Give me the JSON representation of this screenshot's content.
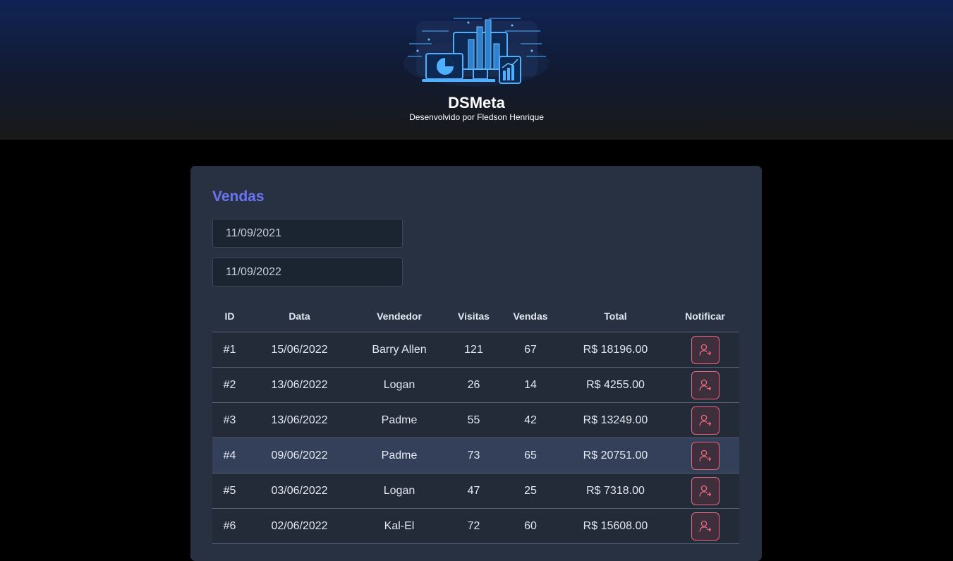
{
  "header": {
    "title": "DSMeta",
    "subtitle": "Desenvolvido por Fledson Henrique",
    "logo_icon": "dashboard-devices-illustration"
  },
  "sales": {
    "title": "Vendas",
    "filters": {
      "min_date": "11/09/2021",
      "max_date": "11/09/2022"
    },
    "columns": [
      "ID",
      "Data",
      "Vendedor",
      "Visitas",
      "Vendas",
      "Total",
      "Notificar"
    ],
    "rows": [
      {
        "id": "#1",
        "date": "15/06/2022",
        "seller": "Barry Allen",
        "visits": "121",
        "sales": "67",
        "total": "R$ 18196.00"
      },
      {
        "id": "#2",
        "date": "13/06/2022",
        "seller": "Logan",
        "visits": "26",
        "sales": "14",
        "total": "R$ 4255.00"
      },
      {
        "id": "#3",
        "date": "13/06/2022",
        "seller": "Padme",
        "visits": "55",
        "sales": "42",
        "total": "R$ 13249.00"
      },
      {
        "id": "#4",
        "date": "09/06/2022",
        "seller": "Padme",
        "visits": "73",
        "sales": "65",
        "total": "R$ 20751.00"
      },
      {
        "id": "#5",
        "date": "03/06/2022",
        "seller": "Logan",
        "visits": "47",
        "sales": "25",
        "total": "R$ 7318.00"
      },
      {
        "id": "#6",
        "date": "02/06/2022",
        "seller": "Kal-El",
        "visits": "72",
        "sales": "60",
        "total": "R$ 15608.00"
      }
    ],
    "notify_icon": "notify-user-icon"
  },
  "colors": {
    "accent": "#6b74f0",
    "notify": "#e4697f",
    "card": "#283142",
    "row_hover": "#34405a"
  }
}
